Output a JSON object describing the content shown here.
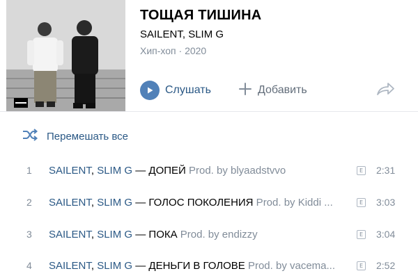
{
  "album": {
    "cover_text": "ТОЩАЯ ТИШИНА",
    "cover_badge": "PARENTAL ADVISORY EXPLICIT CONTENT",
    "title": "ТОЩАЯ ТИШИНА",
    "artists": "SAILENT, SLIM G",
    "genre": "Хип-хоп",
    "dot": "·",
    "year": "2020"
  },
  "actions": {
    "listen_label": "Слушать",
    "add_label": "Добавить",
    "play_icon": "play-icon",
    "add_icon": "plus-icon",
    "share_icon": "share-arrow-icon"
  },
  "shuffle": {
    "label": "Перемешать все",
    "icon": "shuffle-icon"
  },
  "tracks": [
    {
      "num": "1",
      "artist1": "SAILENT",
      "comma": ", ",
      "artist2": "SLIM G",
      "dash": " — ",
      "title": "ДОПЕЙ",
      "subtitle": " Prod. by blyaadstvvo",
      "explicit": "E",
      "duration": "2:31"
    },
    {
      "num": "2",
      "artist1": "SAILENT",
      "comma": ", ",
      "artist2": "SLIM G",
      "dash": " — ",
      "title": "ГОЛОС ПОКОЛЕНИЯ",
      "subtitle": " Prod. by Kiddi ...",
      "explicit": "E",
      "duration": "3:03"
    },
    {
      "num": "3",
      "artist1": "SAILENT",
      "comma": ", ",
      "artist2": "SLIM G",
      "dash": " — ",
      "title": "ПОКА",
      "subtitle": " Prod. by endizzy",
      "explicit": "E",
      "duration": "3:04"
    },
    {
      "num": "4",
      "artist1": "SAILENT",
      "comma": ", ",
      "artist2": "SLIM G",
      "dash": " — ",
      "title": "ДЕНЬГИ В ГОЛОВЕ",
      "subtitle": " Prod. by vacema...",
      "explicit": "E",
      "duration": "2:52"
    }
  ],
  "colors": {
    "accent": "#5181b8",
    "link": "#2a5885",
    "secondary": "#818c99"
  }
}
